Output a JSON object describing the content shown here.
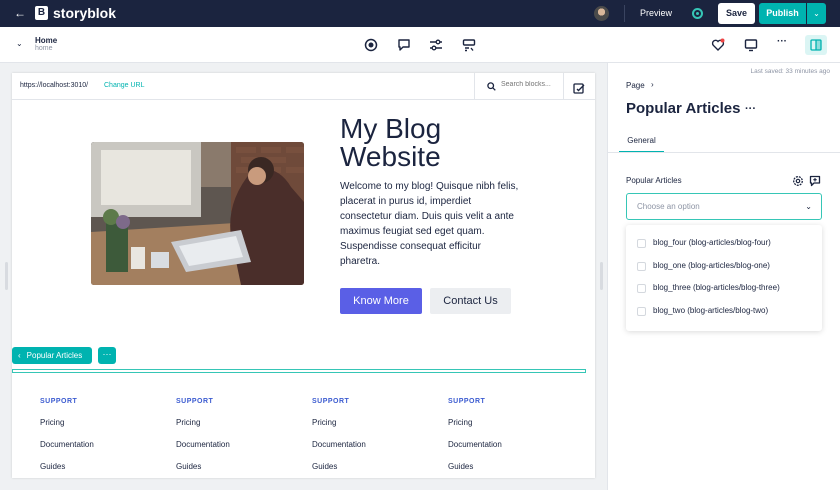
{
  "topbar": {
    "back_icon": "arrow-left-icon",
    "logo_letter": "B",
    "logo_text": "storyblok",
    "preview_label": "Preview",
    "save_label": "Save",
    "publish_label": "Publish",
    "publish_caret": "⌄",
    "accent_color": "#00b3b0",
    "bg_color": "#1b243f"
  },
  "subbar": {
    "chevron": "⌄",
    "story_title": "Home",
    "story_slug": "home",
    "more_label": "···"
  },
  "canvas": {
    "url": "https://localhost:3010/",
    "change_url_label": "Change URL",
    "search_placeholder": "Search blocks...",
    "hero_title": "My Blog Website",
    "hero_text": "Welcome to my blog! Quisque nibh felis, placerat in purus id, imperdiet consectetur diam. Duis quis velit a ante maximus feugiat sed eget quam. Suspendisse consequat efficitur pharetra.",
    "primary_button": "Know More",
    "secondary_button": "Contact Us",
    "selected_block_label": "Popular Articles",
    "selected_block_more": "···",
    "footer_columns": [
      {
        "heading": "SUPPORT",
        "links": [
          "Pricing",
          "Documentation",
          "Guides"
        ]
      },
      {
        "heading": "SUPPORT",
        "links": [
          "Pricing",
          "Documentation",
          "Guides"
        ]
      },
      {
        "heading": "SUPPORT",
        "links": [
          "Pricing",
          "Documentation",
          "Guides"
        ]
      },
      {
        "heading": "SUPPORT",
        "links": [
          "Pricing",
          "Documentation",
          "Guides"
        ]
      }
    ]
  },
  "panel": {
    "last_saved": "Last saved: 33 minutes ago",
    "breadcrumb": "Page",
    "title": "Popular Articles",
    "title_more": "···",
    "tab_general": "General",
    "field_label": "Popular Articles",
    "select_placeholder": "Choose an option",
    "options": [
      "blog_four (blog-articles/blog-four)",
      "blog_one (blog-articles/blog-one)",
      "blog_three (blog-articles/blog-three)",
      "blog_two (blog-articles/blog-two)"
    ]
  }
}
